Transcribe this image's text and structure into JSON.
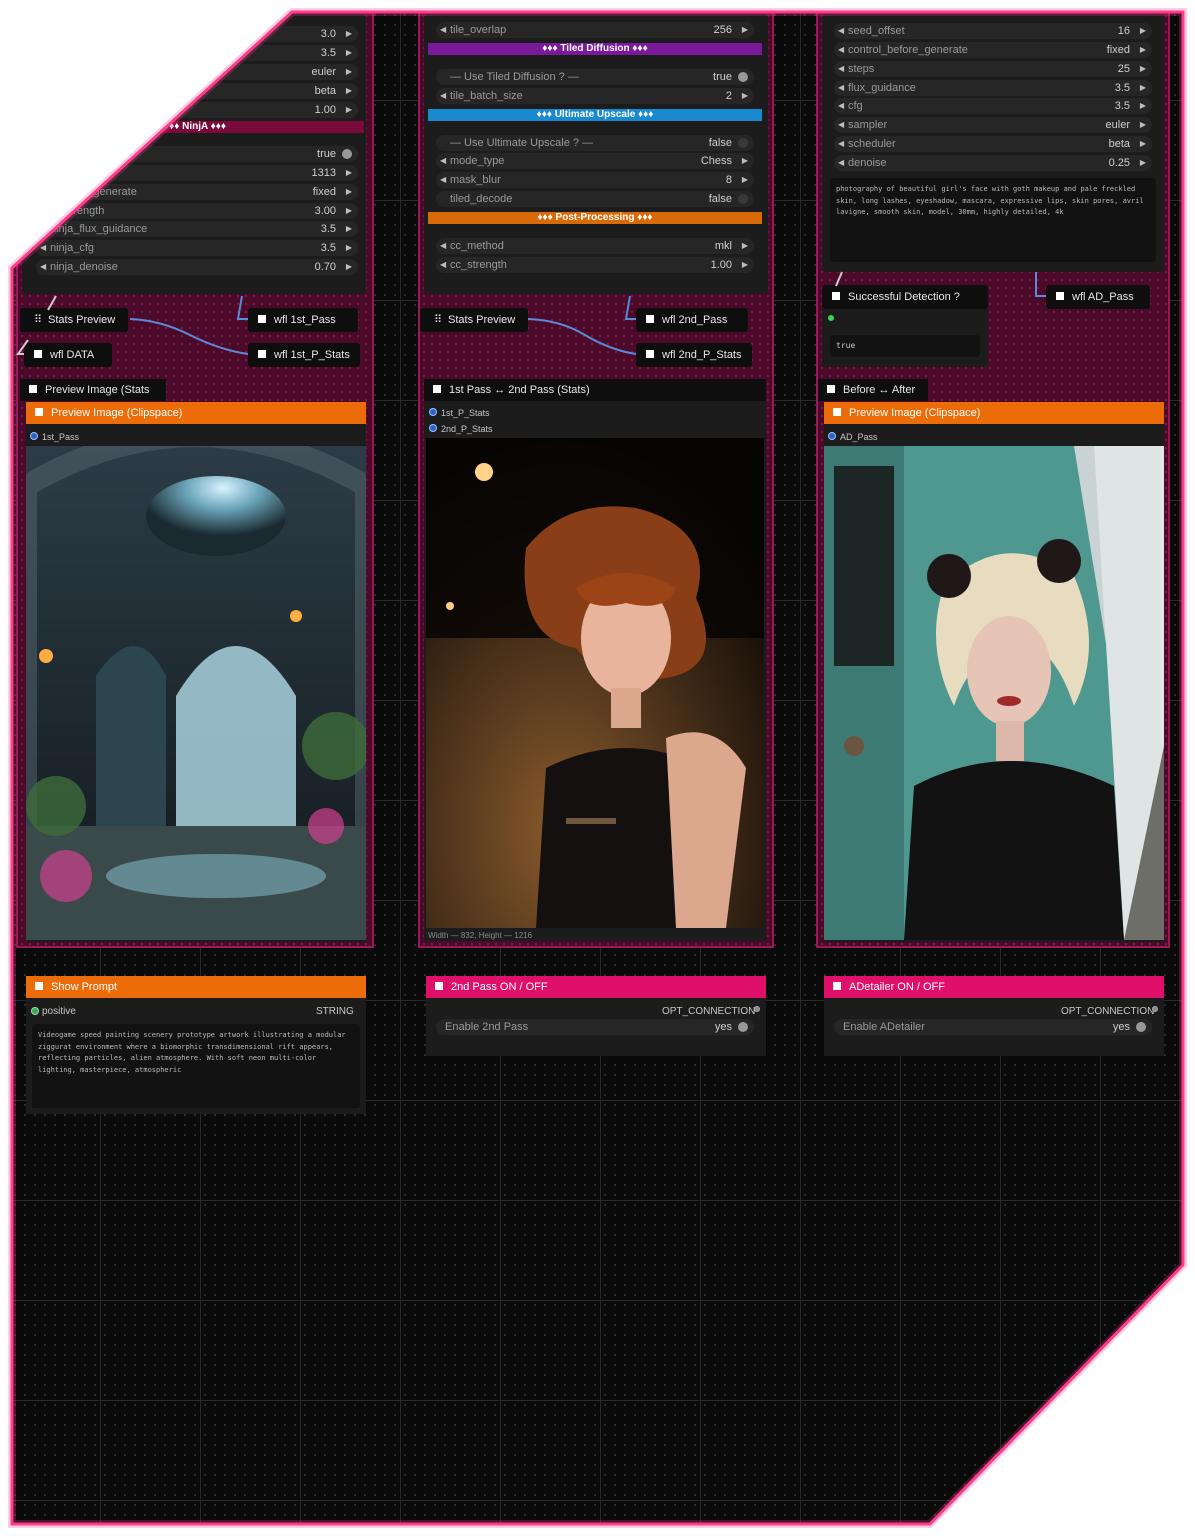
{
  "colors": {
    "accent_pink": "#e0106a",
    "accent_orange": "#ec6c0a",
    "group_purple": "#4c0a2b",
    "tiled_banner": "#7a1a9a",
    "upscale_banner": "#1a8ad0"
  },
  "left_col": {
    "top_values": [
      "3.0",
      "3.5",
      "euler",
      "beta",
      "1.00"
    ],
    "ninja_banner": "♦♦♦ NinjA ♦♦♦",
    "widgets": [
      {
        "label": "",
        "value": "true"
      },
      {
        "label": "_offset",
        "value": "1313"
      },
      {
        "label": "_before_generate",
        "value": "fixed"
      },
      {
        "label": "ja_strength",
        "value": "3.00"
      },
      {
        "label": "ninja_flux_guidance",
        "value": "3.5"
      },
      {
        "label": "ninja_cfg",
        "value": "3.5"
      },
      {
        "label": "ninja_denoise",
        "value": "0.70"
      }
    ],
    "stats_preview": "Stats Preview",
    "wfl_data": "wfl DATA",
    "wfl_1st_pass": "wfl 1st_Pass",
    "wfl_1st_p_stats": "wfl 1st_P_Stats",
    "preview_stats_title": "Preview Image (Stats",
    "preview_clip_title": "Preview Image (Clipspace)",
    "image_slot": "1st_Pass",
    "show_prompt_title": "Show Prompt",
    "positive_label": "positive",
    "string_label": "STRING",
    "prompt_text": "Videogame speed painting scenery prototype artwork illustrating a modular ziggurat environment where a biomorphic transdimensional rift appears, reflecting particles, alien atmosphere. With soft neon multi-color lighting, masterpiece, atmospheric"
  },
  "mid_col": {
    "tile_overlap": {
      "label": "tile_overlap",
      "value": "256"
    },
    "tiled_banner": "♦♦♦ Tiled Diffusion ♦♦♦",
    "use_tiled": {
      "label": "— Use Tiled Diffusion ? —",
      "value": "true"
    },
    "tile_batch": {
      "label": "tile_batch_size",
      "value": "2"
    },
    "upscale_banner": "♦♦♦ Ultimate Upscale ♦♦♦",
    "use_upscale": {
      "label": "— Use Ultimate Upscale ? —",
      "value": "false"
    },
    "mode_type": {
      "label": "mode_type",
      "value": "Chess"
    },
    "mask_blur": {
      "label": "mask_blur",
      "value": "8"
    },
    "tiled_decode": {
      "label": "tiled_decode",
      "value": "false"
    },
    "post_banner": "♦♦♦ Post-Processing ♦♦♦",
    "cc_method": {
      "label": "cc_method",
      "value": "mkl"
    },
    "cc_strength": {
      "label": "cc_strength",
      "value": "1.00"
    },
    "stats_preview": "Stats Preview",
    "wfl_2nd_pass": "wfl 2nd_Pass",
    "wfl_2nd_p_stats": "wfl 2nd_P_Stats",
    "compare_title": "1st Pass ↔ 2nd Pass (Stats)",
    "slot_a": "1st_P_Stats",
    "slot_b": "2nd_P_Stats",
    "caption": "Width — 832, Height — 1216",
    "toggle_title": "2nd Pass  ON / OFF",
    "opt_connection": "OPT_CONNECTION",
    "enable_label": "Enable 2nd Pass",
    "enable_value": "yes"
  },
  "right_col": {
    "widgets": [
      {
        "label": "seed_offset",
        "value": "16"
      },
      {
        "label": "control_before_generate",
        "value": "fixed"
      },
      {
        "label": "steps",
        "value": "25"
      },
      {
        "label": "flux_guidance",
        "value": "3.5"
      },
      {
        "label": "cfg",
        "value": "3.5"
      },
      {
        "label": "sampler",
        "value": "euler"
      },
      {
        "label": "scheduler",
        "value": "beta"
      },
      {
        "label": "denoise",
        "value": "0.25"
      }
    ],
    "prompt_text": "photography of beautiful girl's face with goth makeup and pale freckled skin, long lashes, eyeshadow, mascara, expressive lips, skin pores, avril lavigne, smooth skin, model, 30mm, highly detailed, 4k",
    "success_title": "Successful Detection ?",
    "success_value": "true",
    "wfl_ad_pass": "wfl AD_Pass",
    "before_after_title": "Before ↔ After",
    "preview_clip_title": "Preview Image (Clipspace)",
    "image_slot": "AD_Pass",
    "toggle_title": "ADetailer  ON / OFF",
    "opt_connection": "OPT_CONNECTION",
    "enable_label": "Enable ADetailer",
    "enable_value": "yes"
  },
  "icons": [
    "grid-icon",
    "square-icon",
    "arrow-left-icon",
    "arrow-right-icon",
    "toggle-dot-icon",
    "socket-icon"
  ]
}
